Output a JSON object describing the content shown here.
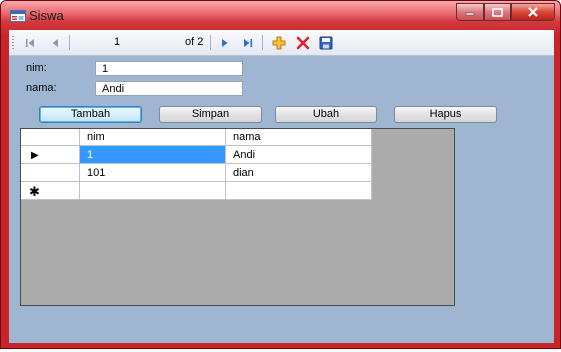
{
  "window": {
    "title": "Siswa",
    "colors": {
      "frame": "#c8242a",
      "client": "#9fb6d2",
      "selection": "#3399ff"
    }
  },
  "navigator": {
    "position": "1",
    "count_label": "of 2",
    "icons": [
      "move-first-icon",
      "move-previous-icon",
      "move-next-icon",
      "move-last-icon",
      "add-new-icon",
      "delete-icon",
      "save-icon"
    ]
  },
  "form": {
    "nim_label": "nim:",
    "nim_value": "1",
    "nama_label": "nama:",
    "nama_value": "Andi"
  },
  "buttons": {
    "tambah": "Tambah",
    "simpan": "Simpan",
    "ubah": "Ubah",
    "hapus": "Hapus"
  },
  "grid": {
    "columns": [
      "nim",
      "nama"
    ],
    "rows": [
      {
        "nim": "1",
        "nama": "Andi",
        "current": true
      },
      {
        "nim": "101",
        "nama": "dian",
        "current": false
      }
    ],
    "new_row_marker": "✱"
  }
}
